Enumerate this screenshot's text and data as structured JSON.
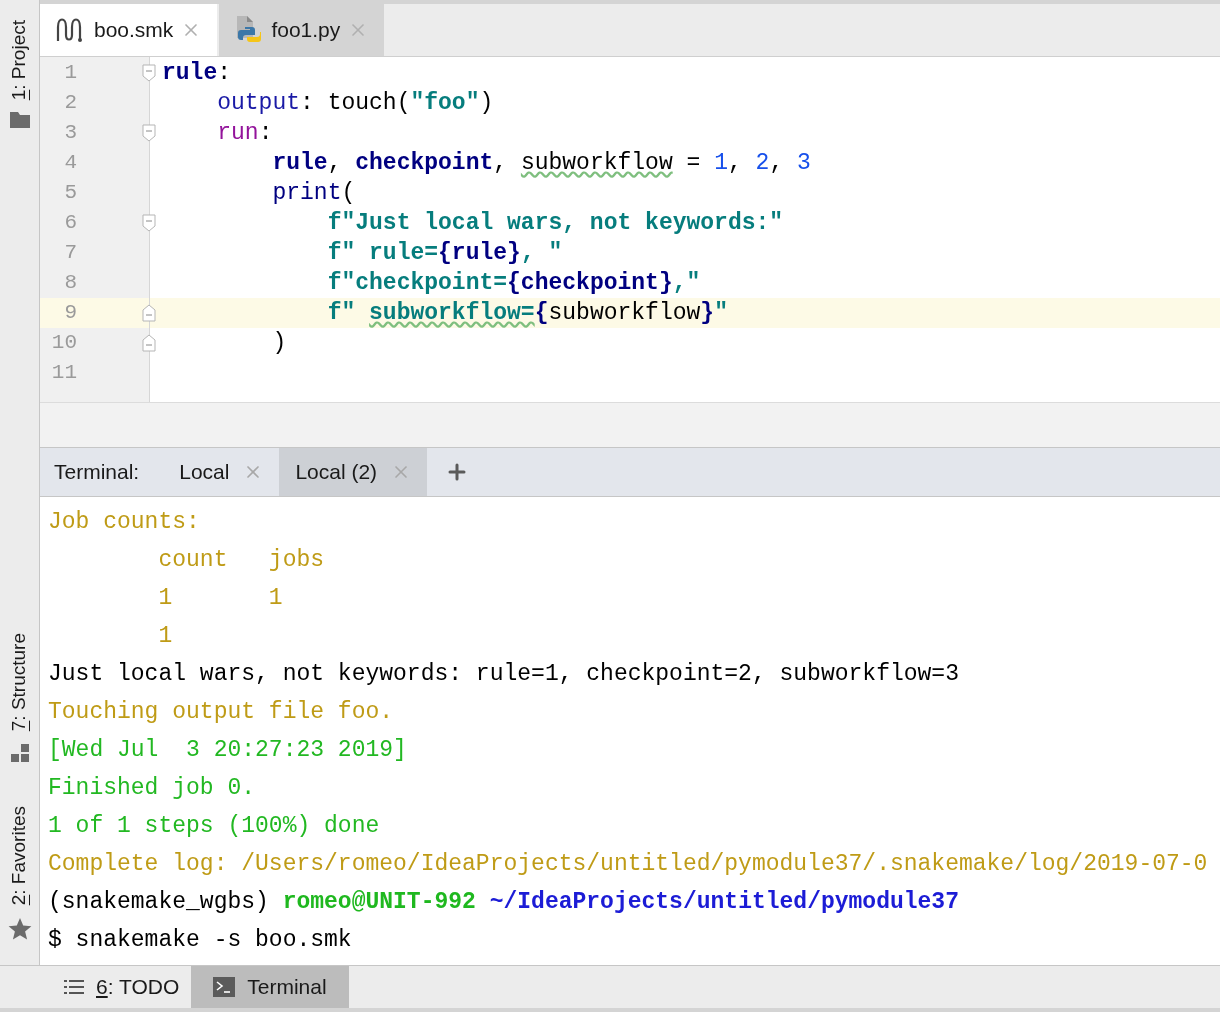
{
  "sidebar": {
    "tools": [
      {
        "kind": "folder",
        "mnemonic": "1",
        "rest": ": Project"
      },
      {
        "kind": "structure",
        "mnemonic": "7",
        "rest": ": Structure"
      },
      {
        "kind": "star",
        "mnemonic": "2",
        "rest": ": Favorites"
      }
    ]
  },
  "editor_tabs": [
    {
      "label": "boo.smk",
      "kind": "snakemake",
      "selected": true
    },
    {
      "label": "foo1.py",
      "kind": "python",
      "selected": false
    }
  ],
  "code_lines": [
    {
      "number": "1",
      "kind": "fold_start",
      "current": false,
      "tokens": [
        {
          "text": "rule",
          "kind": "keyword"
        },
        {
          "text": ":",
          "kind": "plain"
        }
      ]
    },
    {
      "number": "2",
      "kind": "plain",
      "current": false,
      "tokens": [
        {
          "text": "    output",
          "kind": "section"
        },
        {
          "text": ": touch(",
          "kind": "plain"
        },
        {
          "text": "\"foo\"",
          "kind": "string"
        },
        {
          "text": ")",
          "kind": "plain"
        }
      ]
    },
    {
      "number": "3",
      "kind": "fold_start",
      "current": false,
      "tokens": [
        {
          "text": "    run",
          "kind": "run"
        },
        {
          "text": ":",
          "kind": "plain"
        }
      ]
    },
    {
      "number": "4",
      "kind": "plain",
      "current": false,
      "tokens": [
        {
          "text": "        rule",
          "kind": "keyword"
        },
        {
          "text": ", ",
          "kind": "plain"
        },
        {
          "text": "checkpoint",
          "kind": "keyword"
        },
        {
          "text": ", ",
          "kind": "plain"
        },
        {
          "text": "subworkflow",
          "kind": "ident_warn"
        },
        {
          "text": " = ",
          "kind": "plain"
        },
        {
          "text": "1",
          "kind": "number"
        },
        {
          "text": ", ",
          "kind": "plain"
        },
        {
          "text": "2",
          "kind": "number"
        },
        {
          "text": ", ",
          "kind": "plain"
        },
        {
          "text": "3",
          "kind": "number"
        }
      ]
    },
    {
      "number": "5",
      "kind": "plain",
      "current": false,
      "tokens": [
        {
          "text": "        print",
          "kind": "builtin"
        },
        {
          "text": "(",
          "kind": "plain"
        }
      ]
    },
    {
      "number": "6",
      "kind": "fold_start",
      "current": false,
      "tokens": [
        {
          "text": "            f\"Just local wars, not keywords:\"",
          "kind": "string"
        }
      ]
    },
    {
      "number": "7",
      "kind": "plain",
      "current": false,
      "tokens": [
        {
          "text": "            f\" rule=",
          "kind": "string"
        },
        {
          "text": "{rule}",
          "kind": "brace"
        },
        {
          "text": ", \"",
          "kind": "string"
        }
      ]
    },
    {
      "number": "8",
      "kind": "plain",
      "current": false,
      "tokens": [
        {
          "text": "            f\"checkpoint=",
          "kind": "string"
        },
        {
          "text": "{checkpoint}",
          "kind": "brace"
        },
        {
          "text": ",\"",
          "kind": "string"
        }
      ]
    },
    {
      "number": "9",
      "kind": "fold_end",
      "current": true,
      "tokens": [
        {
          "text": "            f\" ",
          "kind": "string"
        },
        {
          "text": "subworkflow=",
          "kind": "string_warn"
        },
        {
          "text": "{",
          "kind": "brace"
        },
        {
          "text": "subworkflow",
          "kind": "plain"
        },
        {
          "text": "}",
          "kind": "brace"
        },
        {
          "text": "\"",
          "kind": "string"
        }
      ]
    },
    {
      "number": "10",
      "kind": "fold_end",
      "current": false,
      "tokens": [
        {
          "text": "        )",
          "kind": "plain"
        }
      ]
    },
    {
      "number": "11",
      "kind": "plain",
      "current": false
    }
  ],
  "terminal": {
    "label": "Terminal:",
    "tabs": [
      {
        "label": "Local",
        "selected": false
      },
      {
        "label": "Local (2)",
        "selected": true
      }
    ],
    "lines": [
      [
        {
          "text": "Job counts:",
          "kind": "yellow"
        }
      ],
      [
        {
          "text": "        count   jobs",
          "kind": "yellow"
        }
      ],
      [
        {
          "text": "        1       1",
          "kind": "yellow"
        }
      ],
      [
        {
          "text": "        1",
          "kind": "yellow"
        }
      ],
      [
        {
          "text": "Just local wars, not keywords: rule=1, checkpoint=2, subworkflow=3",
          "kind": "plain"
        }
      ],
      [
        {
          "text": "Touching output file foo.",
          "kind": "yellow"
        }
      ],
      [
        {
          "text": "[Wed Jul  3 20:27:23 2019]",
          "kind": "green"
        }
      ],
      [
        {
          "text": "Finished job 0.",
          "kind": "green"
        }
      ],
      [
        {
          "text": "1 of 1 steps (100%) done",
          "kind": "green"
        }
      ],
      [
        {
          "text": "Complete log: /Users/romeo/IdeaProjects/untitled/pymodule37/.snakemake/log/2019-07-0",
          "kind": "yellow"
        }
      ],
      [
        {
          "text": "(snakemake_wgbs)",
          "kind": "plain"
        },
        {
          "text": " romeo@UNIT-992",
          "kind": "bold_green"
        },
        {
          "text": " ~/IdeaProjects/untitled/pymodule37",
          "kind": "bold_blue"
        }
      ],
      [
        {
          "text": "$ snakemake -s boo.smk",
          "kind": "plain"
        }
      ]
    ]
  },
  "bottom_bar": {
    "tools": [
      {
        "kind": "todo",
        "mnemonic": "6",
        "rest": ": TODO",
        "selected": false
      },
      {
        "kind": "terminal",
        "rest": "Terminal",
        "selected": true
      }
    ]
  }
}
